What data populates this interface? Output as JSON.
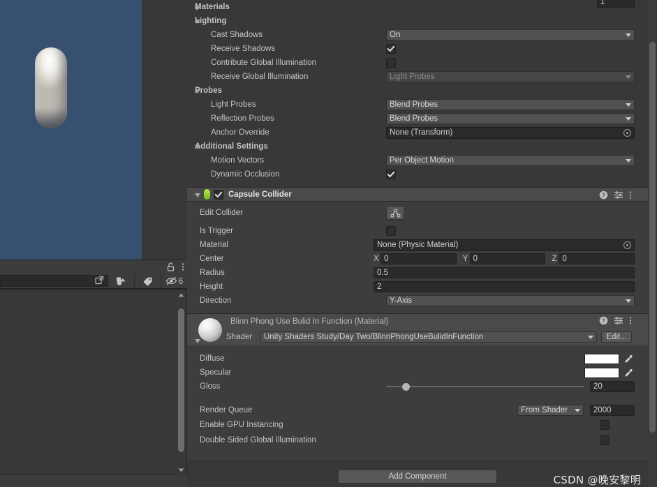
{
  "scene": {
    "name": "scene-viewport",
    "background_color": "#37506f",
    "object": "capsule"
  },
  "hierarchy_panel": {
    "search_placeholder": "",
    "search_value": "",
    "hidden_count": "6",
    "icons": [
      "lock-icon",
      "kebab-menu-icon",
      "expand-icon",
      "object-picker-icon",
      "tag-icon",
      "eye-off-icon"
    ]
  },
  "inspector": {
    "materials": {
      "label": "Materials",
      "count": "1",
      "expanded": false
    },
    "lighting": {
      "label": "Lighting",
      "expanded": true,
      "rows": [
        {
          "label": "Cast Shadows",
          "type": "dropdown",
          "value": "On"
        },
        {
          "label": "Receive Shadows",
          "type": "checkbox",
          "value": true
        },
        {
          "label": "Contribute Global Illumination",
          "type": "checkbox",
          "value": false
        },
        {
          "label": "Receive Global Illumination",
          "type": "dropdown",
          "value": "Light Probes",
          "disabled": true
        }
      ]
    },
    "probes": {
      "label": "Probes",
      "expanded": true,
      "rows": [
        {
          "label": "Light Probes",
          "type": "dropdown",
          "value": "Blend Probes"
        },
        {
          "label": "Reflection Probes",
          "type": "dropdown",
          "value": "Blend Probes"
        },
        {
          "label": "Anchor Override",
          "type": "object",
          "value": "None (Transform)"
        }
      ]
    },
    "additional_settings": {
      "label": "Additional Settings",
      "expanded": true,
      "rows": [
        {
          "label": "Motion Vectors",
          "type": "dropdown",
          "value": "Per Object Motion"
        },
        {
          "label": "Dynamic Occlusion",
          "type": "checkbox",
          "value": true
        }
      ]
    },
    "capsule_collider": {
      "title": "Capsule Collider",
      "enabled": true,
      "expanded": true,
      "edit_collider_label": "Edit Collider",
      "is_trigger_label": "Is Trigger",
      "is_trigger_value": false,
      "material_label": "Material",
      "material_value": "None (Physic Material)",
      "center_label": "Center",
      "center": {
        "x_axis": "X",
        "x": "0",
        "y_axis": "Y",
        "y": "0",
        "z_axis": "Z",
        "z": "0"
      },
      "radius_label": "Radius",
      "radius_value": "0.5",
      "height_label": "Height",
      "height_value": "2",
      "direction_label": "Direction",
      "direction_value": "Y-Axis"
    },
    "material": {
      "title": "Blinn Phong Use Bulid In Function (Material)",
      "shader_label": "Shader",
      "shader_value": "Unity Shaders Study/Day Two/BlinnPhongUseBulidInFunction",
      "edit_label": "Edit...",
      "properties": [
        {
          "label": "Diffuse",
          "type": "color",
          "value": "#ffffff"
        },
        {
          "label": "Specular",
          "type": "color",
          "value": "#ffffff"
        },
        {
          "label": "Gloss",
          "type": "slider",
          "value": "20",
          "percent": 8
        }
      ],
      "render_queue_label": "Render Queue",
      "render_queue_mode": "From Shader",
      "render_queue_value": "2000",
      "gpu_instancing_label": "Enable GPU Instancing",
      "gpu_instancing_value": false,
      "double_sided_gi_label": "Double Sided Global Illumination",
      "double_sided_gi_value": false
    },
    "add_component_label": "Add Component"
  },
  "watermark": "CSDN @晚安黎明"
}
